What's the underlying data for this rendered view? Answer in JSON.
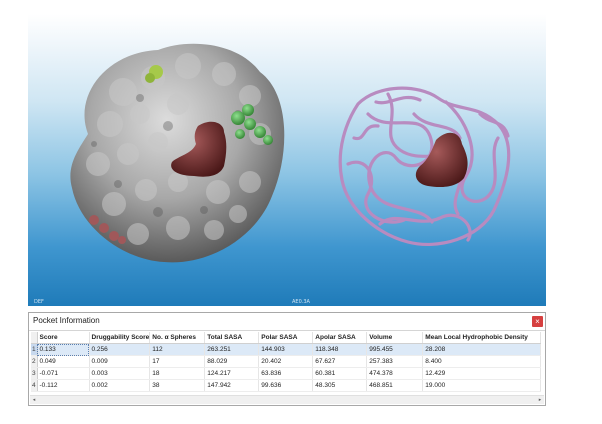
{
  "viewport": {
    "left_caption": "DEF",
    "mid_caption": "AE0.3A",
    "colors": {
      "protein_surface": "#9c9c9c",
      "pocket_1": "#6f2f2f",
      "pocket_2": "#3f9f3f",
      "pocket_3": "#9ec33e",
      "pocket_4": "#a0585a",
      "backbone": "#b88bc0"
    }
  },
  "panel": {
    "title": "Pocket Information",
    "close_label": "×",
    "scroll_left": "◂",
    "scroll_right": "▸",
    "columns": [
      "Score",
      "Druggability Score",
      "No. α Spheres",
      "Total SASA",
      "Polar SASA",
      "Apolar SASA",
      "Volume",
      "Mean Local Hydrophobic Density"
    ],
    "rows": [
      {
        "num": "1",
        "cells": [
          "0.133",
          "0.256",
          "112",
          "263.251",
          "144.903",
          "118.348",
          "995.455",
          "28.208"
        ]
      },
      {
        "num": "2",
        "cells": [
          "0.049",
          "0.009",
          "17",
          "88.029",
          "20.402",
          "67.627",
          "257.383",
          "8.400"
        ]
      },
      {
        "num": "3",
        "cells": [
          "-0.071",
          "0.003",
          "18",
          "124.217",
          "63.836",
          "60.381",
          "474.378",
          "12.429"
        ]
      },
      {
        "num": "4",
        "cells": [
          "-0.112",
          "0.002",
          "38",
          "147.942",
          "99.636",
          "48.305",
          "468.851",
          "19.000"
        ]
      }
    ],
    "selected_row": 0
  }
}
